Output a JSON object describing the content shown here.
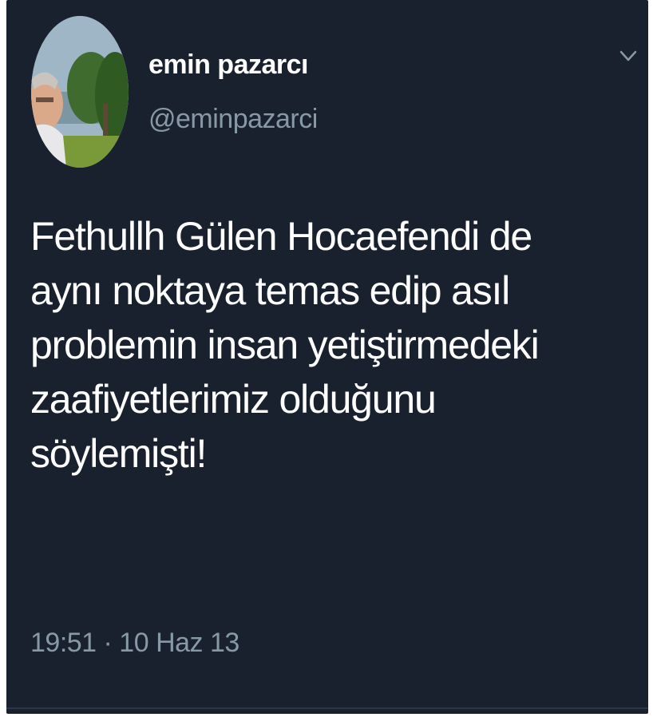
{
  "tweet": {
    "author": {
      "display_name": "emin pazarcı",
      "handle": "@eminpazarci",
      "avatar_icon": "profile-photo"
    },
    "text": "Fethullh Gülen Hocaefendi de\naynı noktaya temas edip asıl\nproblemin insan yetiştirmedeki\nzaafiyetlerimiz olduğunu\nsöylemişti!",
    "timestamp": "19:51 · 10 Haz 13",
    "menu_icon": "chevron-down-icon"
  },
  "theme": {
    "background": "#18212d",
    "text": "#ffffff",
    "secondary_text": "#8899a6"
  }
}
